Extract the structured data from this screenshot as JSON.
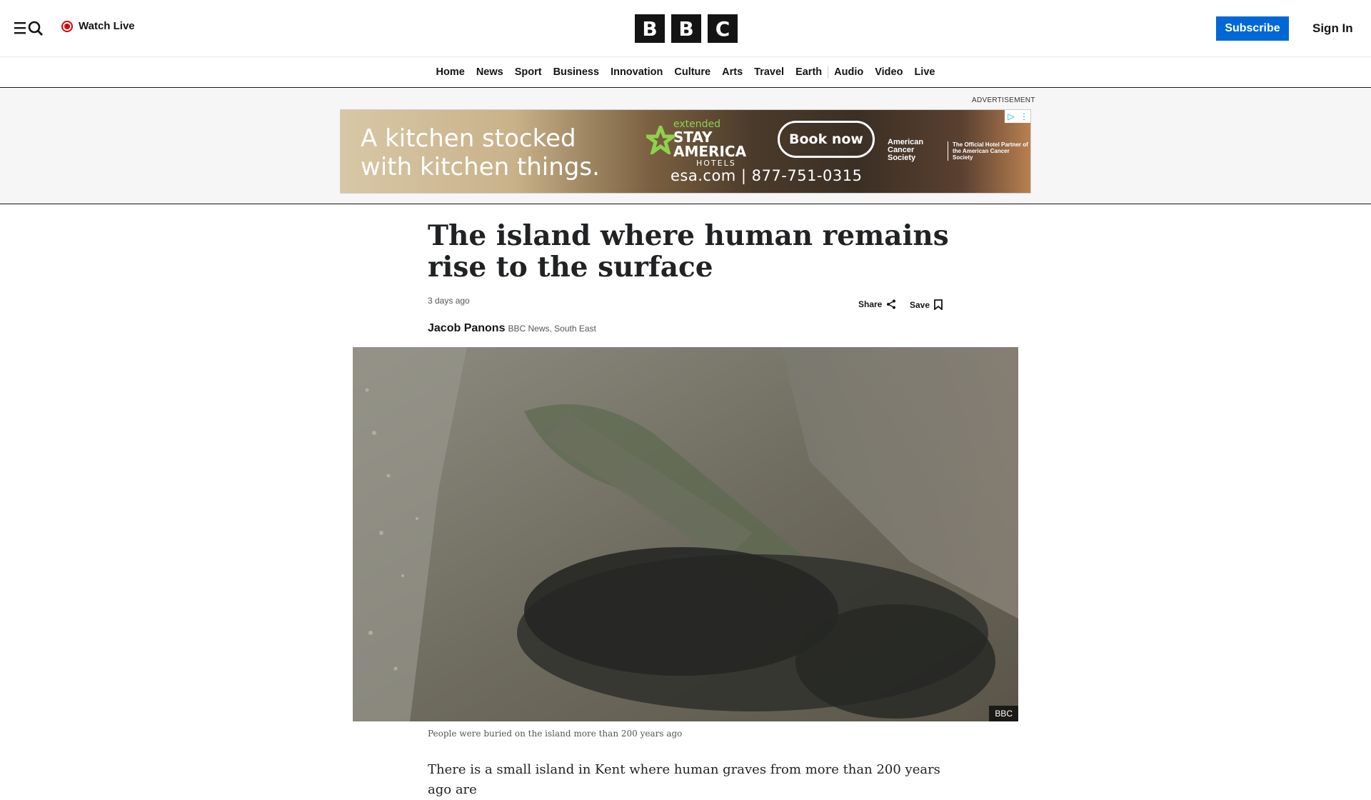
{
  "header": {
    "watch_live": "Watch Live",
    "logo_letters": [
      "B",
      "B",
      "C"
    ],
    "subscribe": "Subscribe",
    "sign_in": "Sign In"
  },
  "nav": {
    "items": [
      "Home",
      "News",
      "Sport",
      "Business",
      "Innovation",
      "Culture",
      "Arts",
      "Travel",
      "Earth",
      "Audio",
      "Video",
      "Live"
    ]
  },
  "ad": {
    "label": "ADVERTISEMENT",
    "headline_line1": "A kitchen stocked",
    "headline_line2": "with kitchen things.",
    "brand_extended": "extended",
    "brand_stay": "STAY",
    "brand_america": "AMERICA",
    "brand_hotels": "HOTELS",
    "cta": "Book now",
    "contact": "esa.com  |  877-751-0315",
    "partner_name": "American Cancer Society",
    "partner_note": "The Official Hotel Partner of the American Cancer Society"
  },
  "article": {
    "headline": "The island where human remains rise to the surface",
    "timestamp": "3 days ago",
    "share_label": "Share",
    "save_label": "Save",
    "author": "Jacob Panons",
    "department": "BBC News, South East",
    "image_credit": "BBC",
    "caption": "People were buried on the island more than 200 years ago",
    "first_paragraph": "There is a small island in Kent where human graves from more than 200 years ago are"
  },
  "colors": {
    "brand_black": "#141414",
    "subscribe_blue": "#0068d6",
    "live_red": "#dd0000"
  }
}
